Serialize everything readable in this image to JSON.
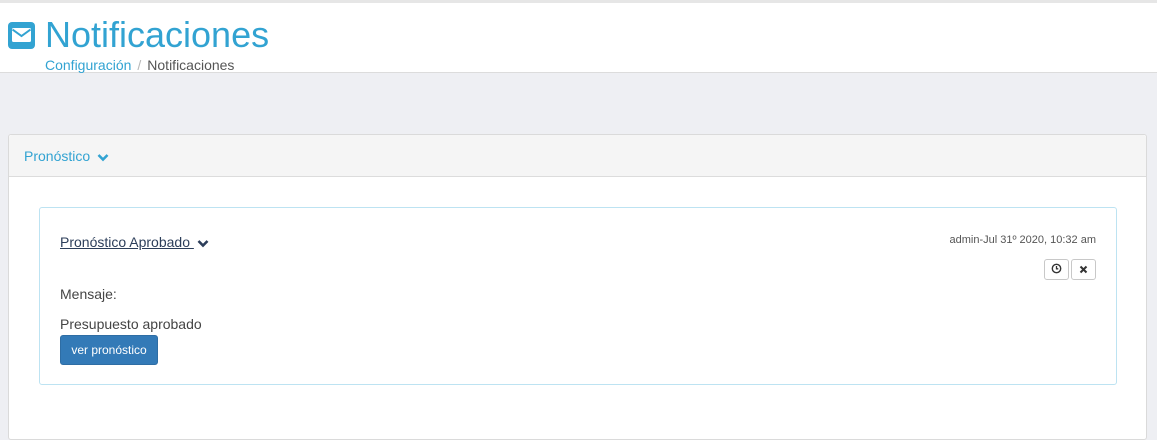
{
  "header": {
    "title": "Notificaciones",
    "icon": "envelope-icon",
    "accent": "#32a3d2"
  },
  "breadcrumb": {
    "items": [
      "Configuración",
      "Notificaciones"
    ],
    "separator": "/"
  },
  "section": {
    "label": "Pronóstico",
    "icon": "chevron-down-icon"
  },
  "notification": {
    "title": "Pronóstico Aprobado",
    "meta": "admin-Jul 31º 2020, 10:32 am",
    "message_label": "Mensaje:",
    "message": "Presupuesto aprobado",
    "button_label": "ver pronóstico",
    "button_color": "#337ab7",
    "actions": [
      "clock-icon",
      "close-icon"
    ]
  }
}
